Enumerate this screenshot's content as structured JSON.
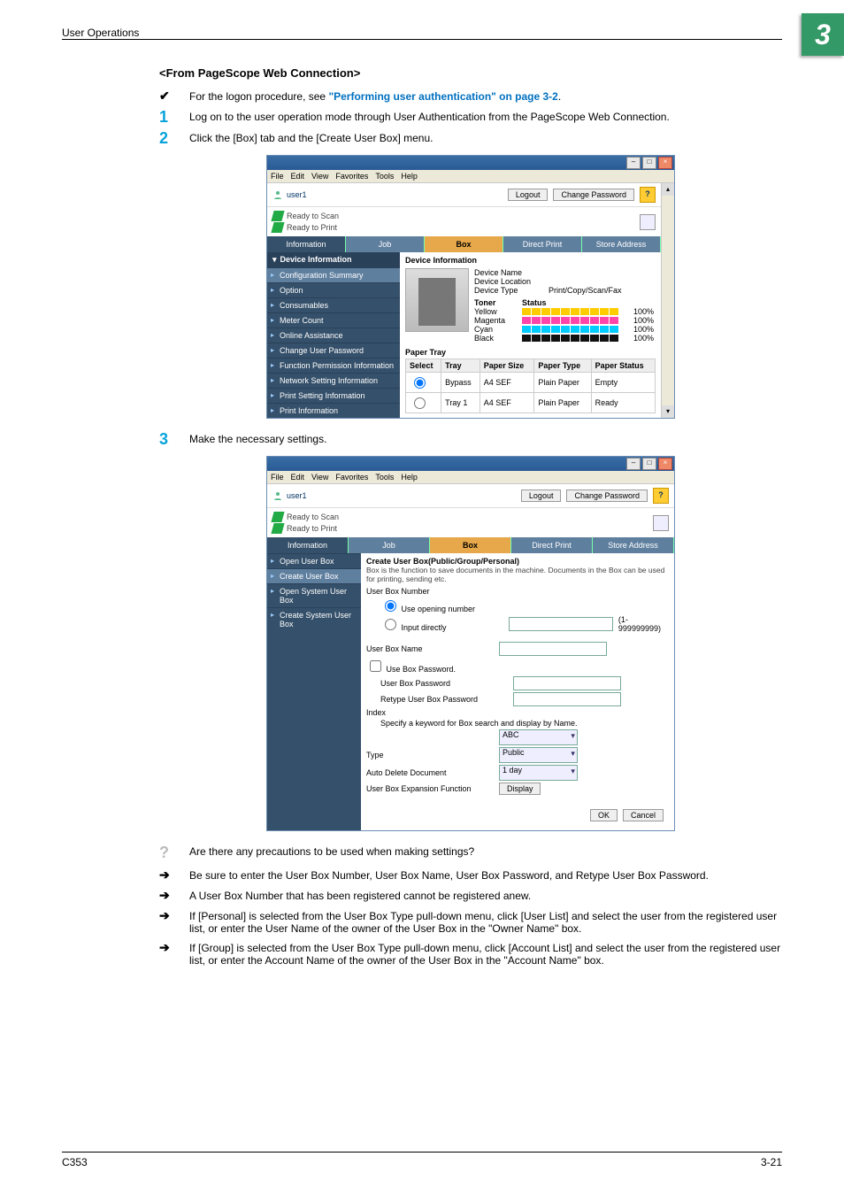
{
  "page": {
    "header_title": "User Operations",
    "chapter_number": "3",
    "footer_left": "C353",
    "footer_right": "3-21"
  },
  "section": {
    "heading": "<From PageScope Web Connection>",
    "check_prefix": "For the logon procedure, see ",
    "check_link": "\"Performing user authentication\" on page 3-2",
    "check_suffix": ".",
    "steps": [
      "Log on to the user operation mode through User Authentication from the PageScope Web Connection.",
      "Click the [Box] tab and the [Create User Box] menu.",
      "Make the necessary settings."
    ],
    "qa_question": "Are there any precautions to be used when making settings?",
    "answers": [
      "Be sure to enter the User Box Number, User Box Name, User Box Password, and Retype User Box Password.",
      "A User Box Number that has been registered cannot be registered anew.",
      "If [Personal] is selected from the User Box Type pull-down menu, click [User List] and select the user from the registered user list, or enter the User Name of the owner of the User Box in the \"Owner Name\" box.",
      "If [Group] is selected from the User Box Type pull-down menu, click [Account List] and select the user from the registered user list, or enter the Account Name of the owner of the User Box in the \"Account Name\" box."
    ]
  },
  "browser_menu": {
    "items": [
      "File",
      "Edit",
      "View",
      "Favorites",
      "Tools",
      "Help"
    ]
  },
  "common": {
    "user": "user1",
    "logout": "Logout",
    "change_password": "Change Password",
    "help_mark": "?",
    "ready_scan": "Ready to Scan",
    "ready_print": "Ready to Print",
    "ok": "OK",
    "cancel": "Cancel"
  },
  "tabs": [
    "Information",
    "Job",
    "Box",
    "Direct Print",
    "Store Address"
  ],
  "win1": {
    "sidebar_header": "Device Information",
    "sidebar": [
      "Configuration Summary",
      "Option",
      "Consumables",
      "Meter Count",
      "Online Assistance",
      "Change User Password",
      "Function Permission Information",
      "Network Setting Information",
      "Print Setting Information",
      "Print Information"
    ],
    "device_info_heading": "Device Information",
    "device_fields": {
      "name_label": "Device Name",
      "location_label": "Device Location",
      "type_label": "Device Type",
      "type_value": "Print/Copy/Scan/Fax"
    },
    "toner": {
      "header_name": "Toner",
      "header_status": "Status",
      "rows": [
        {
          "name": "Yellow",
          "pct": "100%"
        },
        {
          "name": "Magenta",
          "pct": "100%"
        },
        {
          "name": "Cyan",
          "pct": "100%"
        },
        {
          "name": "Black",
          "pct": "100%"
        }
      ]
    },
    "paper_tray_heading": "Paper Tray",
    "paper_tray": {
      "headers": [
        "Select",
        "Tray",
        "Paper Size",
        "Paper Type",
        "Paper Status"
      ],
      "rows": [
        {
          "tray": "Bypass",
          "size": "A4 SEF",
          "type": "Plain Paper",
          "status": "Empty"
        },
        {
          "tray": "Tray 1",
          "size": "A4 SEF",
          "type": "Plain Paper",
          "status": "Ready"
        }
      ]
    }
  },
  "win2": {
    "sidebar": [
      "Open User Box",
      "Create User Box",
      "Open System User Box",
      "Create System User Box"
    ],
    "form_heading": "Create User Box(Public/Group/Personal)",
    "form_note": "Box is the function to save documents in the machine. Documents in the Box can be used for printing, sending etc.",
    "labels": {
      "user_box_number": "User Box Number",
      "use_opening_number": "Use opening number",
      "input_directly": "Input directly",
      "range_hint": "(1-999999999)",
      "user_box_name": "User Box Name",
      "use_box_password": "Use Box Password.",
      "user_box_password": "User Box Password",
      "retype_password": "Retype User Box Password",
      "index": "Index",
      "index_hint": "Specify a keyword for Box search and display by Name.",
      "type": "Type",
      "auto_delete": "Auto Delete Document",
      "expansion": "User Box Expansion Function"
    },
    "values": {
      "index_sel": "ABC",
      "type_sel": "Public",
      "auto_delete_sel": "1 day",
      "expansion_btn": "Display"
    }
  }
}
